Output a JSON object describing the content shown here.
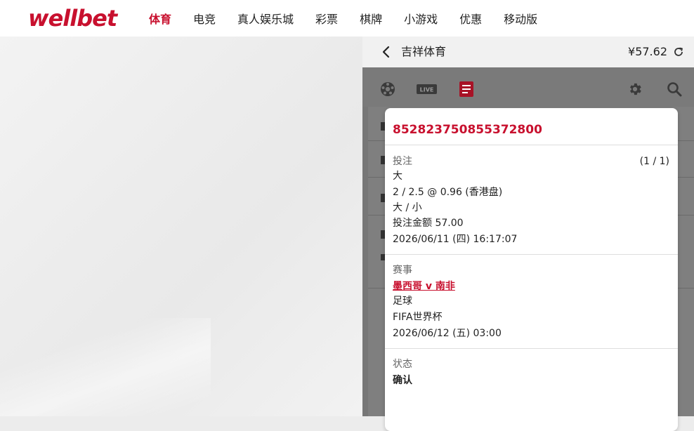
{
  "brand": {
    "logo_text": "wellbet",
    "accent": "#c8102e"
  },
  "nav": {
    "items": [
      {
        "label": "体育",
        "active": true
      },
      {
        "label": "电竞"
      },
      {
        "label": "真人娱乐城"
      },
      {
        "label": "彩票"
      },
      {
        "label": "棋牌"
      },
      {
        "label": "小游戏"
      },
      {
        "label": "优惠"
      },
      {
        "label": "移动版"
      }
    ]
  },
  "panel": {
    "title": "吉祥体育",
    "balance": "¥57.62",
    "toolbar_icons": [
      "soccer-ball-icon",
      "live-icon",
      "bet-slip-icon",
      "settings-gear-icon",
      "search-icon"
    ],
    "live_label": "LIVE"
  },
  "bet": {
    "id": "852823750855372800",
    "selection_section": {
      "label": "投注",
      "count": "(1 / 1)",
      "selection": "大",
      "odds_line": "2 / 2.5 @ 0.96 (香港盘)",
      "market": "大 / 小",
      "stake": "投注金额 57.00",
      "placed_at": "2026/06/11 (四) 16:17:07"
    },
    "event_section": {
      "label": "赛事",
      "match": "墨西哥 v 南非",
      "sport": "足球",
      "competition": "FIFA世界杯",
      "kickoff": "2026/06/12 (五) 03:00"
    },
    "status_section": {
      "label": "状态",
      "value": "确认"
    }
  }
}
